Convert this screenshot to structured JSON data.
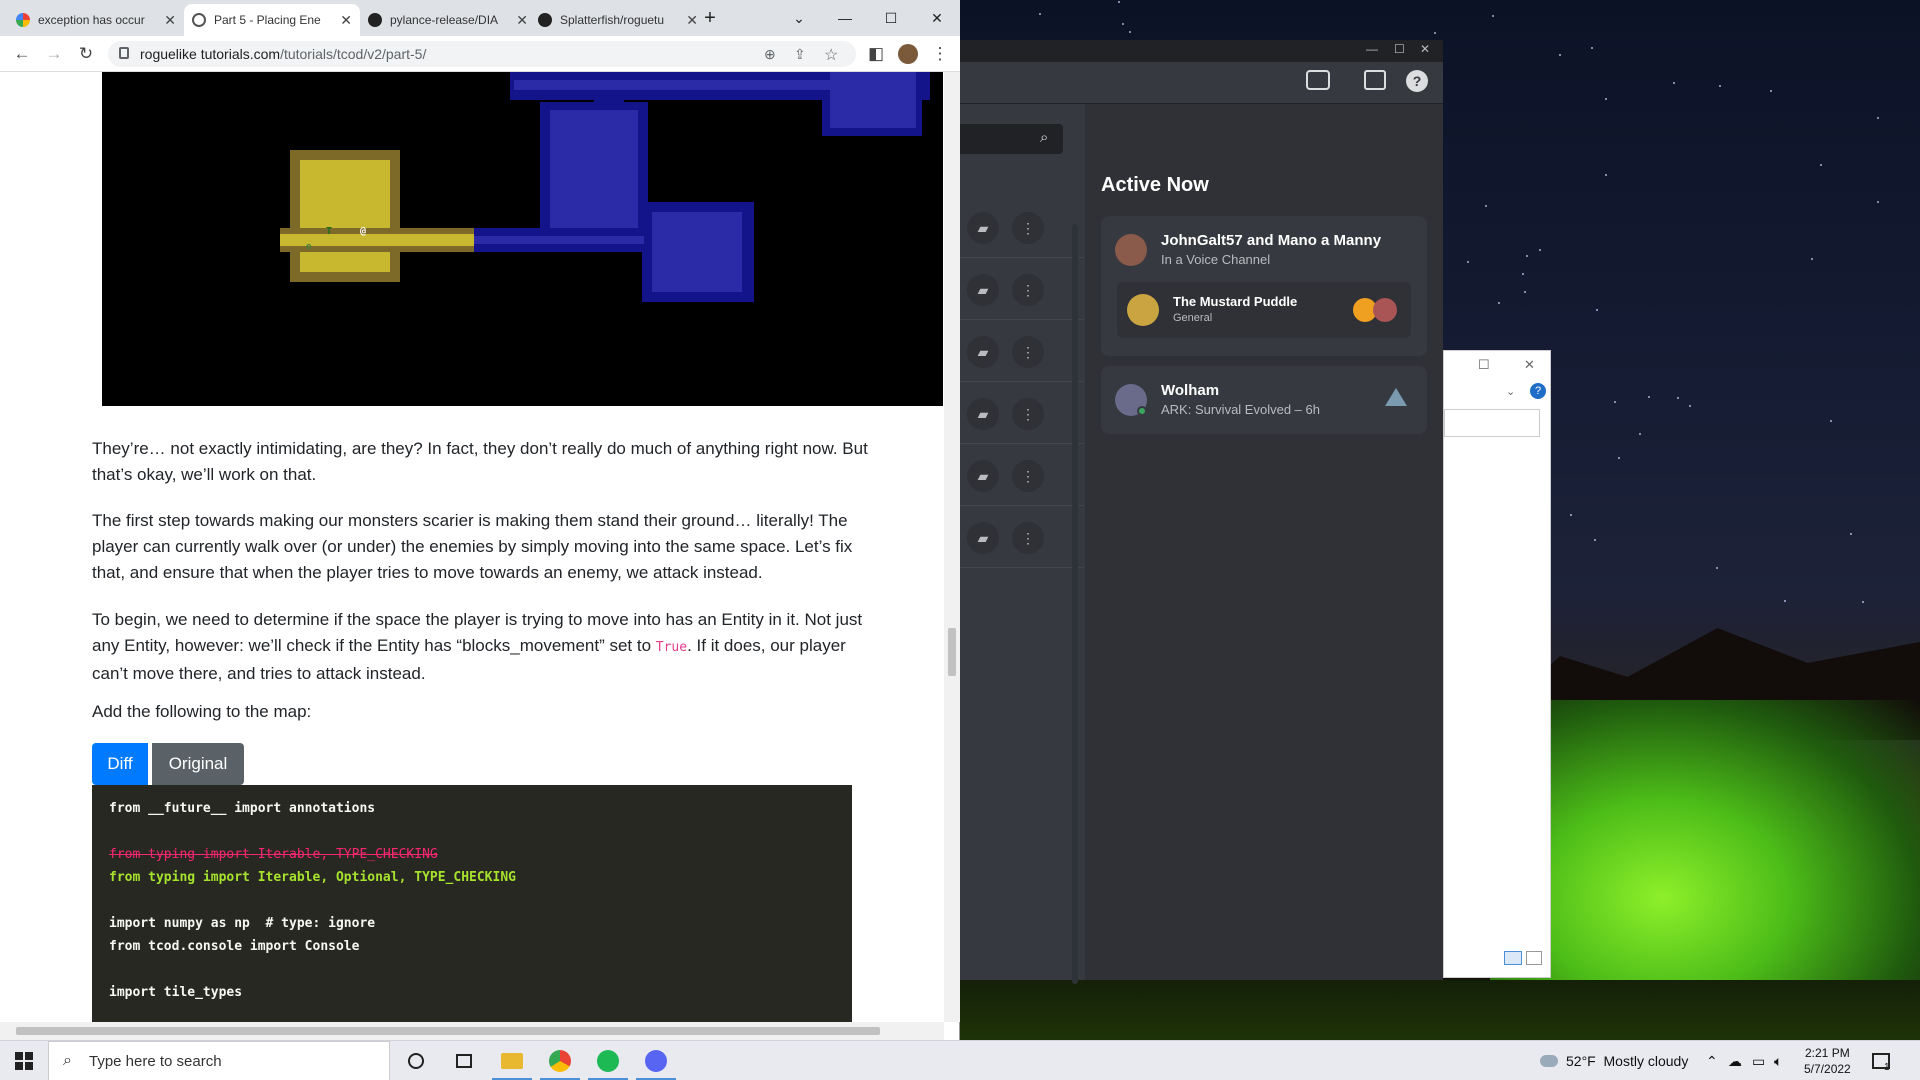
{
  "browser": {
    "tabs": [
      {
        "label": "exception has occur",
        "icon": "google-icon"
      },
      {
        "label": "Part 5 - Placing Ene",
        "icon": "globe-icon"
      },
      {
        "label": "pylance-release/DIA",
        "icon": "github-icon"
      },
      {
        "label": "Splatterfish/roguetu",
        "icon": "github-icon"
      }
    ],
    "new_tab": "+",
    "url_domain": "roguelike tutorials.com",
    "url_host": "roguelike tutorials.com",
    "url_path": "/tutorials/tcod/v2/part-5/"
  },
  "article": {
    "p1": "They’re… not exactly intimidating, are they? In fact, they don’t really do much of anything right now. But that’s okay, we’ll work on that.",
    "p2": "The first step towards making our monsters scarier is making them stand their ground… literally! The player can currently walk over (or under) the enemies by simply moving into the same space. Let’s fix that, and ensure that when the player tries to move towards an enemy, we attack instead.",
    "p3_a": "To begin, we need to determine if the space the player is trying to move into has an Entity in it. Not just any Entity, however: we’ll check if the Entity has “blocks_movement” set to ",
    "p3_code": "True",
    "p3_b": ". If it does, our player can’t move there, and tries to attack instead.",
    "p4": "Add the following to the map:",
    "diff_label": "Diff",
    "original_label": "Original",
    "code_lines": [
      {
        "text": "from __future__ import annotations",
        "kind": "normal"
      },
      {
        "text": "",
        "kind": "normal"
      },
      {
        "text": "from typing import Iterable, TYPE_CHECKING",
        "kind": "del"
      },
      {
        "text": "from typing import Iterable, Optional, TYPE_CHECKING",
        "kind": "add"
      },
      {
        "text": "",
        "kind": "normal"
      },
      {
        "text": "import numpy as np  # type: ignore",
        "kind": "normal"
      },
      {
        "text": "from tcod.console import Console",
        "kind": "normal"
      },
      {
        "text": "",
        "kind": "normal"
      },
      {
        "text": "import tile_types",
        "kind": "normal"
      }
    ],
    "game_glyphs": {
      "troll": "T",
      "player": "@",
      "orc": "o"
    }
  },
  "discord": {
    "active_now_title": "Active Now",
    "cards": [
      {
        "name": "JohnGalt57 and Mano a Manny",
        "status": "In a Voice Channel",
        "server": "The Mustard Puddle",
        "channel": "General"
      },
      {
        "name": "Wolham",
        "status": "ARK: Survival Evolved – 6h"
      }
    ]
  },
  "taskbar": {
    "search_placeholder": "Type here to search",
    "weather_temp": "52°F",
    "weather_text": "Mostly cloudy",
    "time": "2:21 PM",
    "date": "5/7/2022",
    "notifications": "1"
  },
  "colors": {
    "discord_bg": "#36393f",
    "discord_active_bg": "#2f3136",
    "link_blue": "#007bff",
    "code_bg": "#272822",
    "game_lit": "#c8b830",
    "game_dark": "#2a2aa8"
  }
}
